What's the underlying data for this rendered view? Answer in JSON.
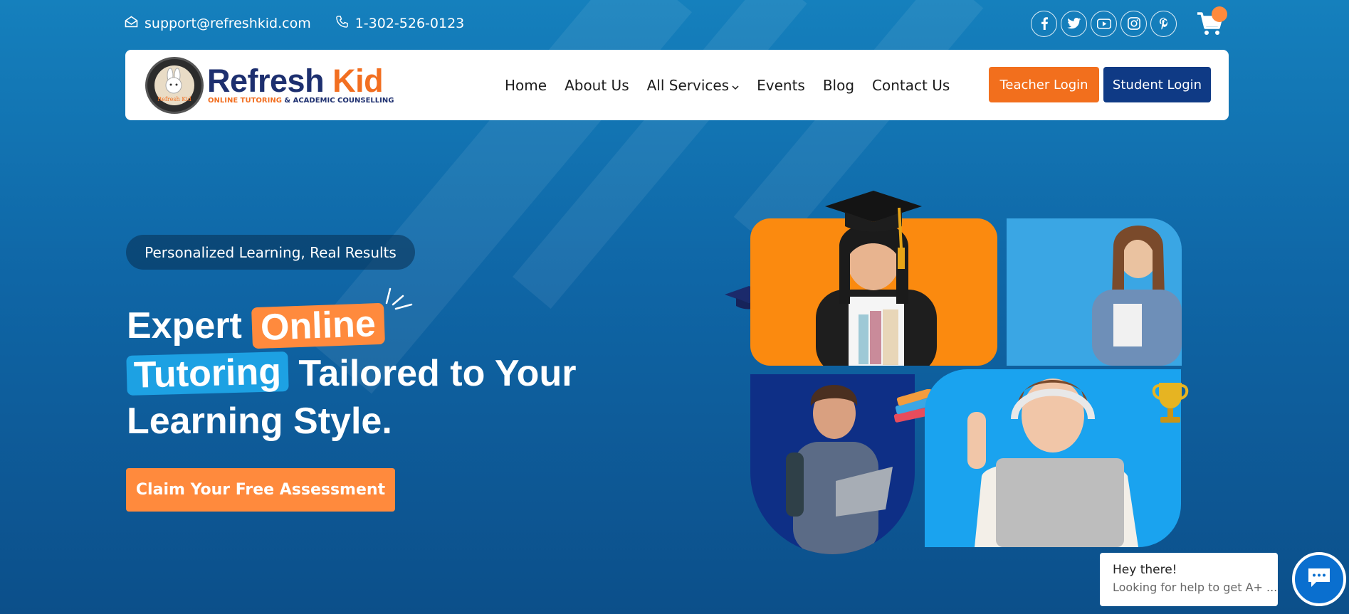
{
  "topbar": {
    "email": "support@refreshkid.com",
    "phone": "1-302-526-0123",
    "socials": [
      "facebook-icon",
      "twitter-icon",
      "youtube-icon",
      "instagram-icon",
      "pinterest-icon"
    ]
  },
  "header": {
    "logo_title_main": "Refresh",
    "logo_title_accent": "Kid",
    "logo_sub_accent": "ONLINE TUTORING",
    "logo_sub_rest": "& ACADEMIC COUNSELLING",
    "logo_badge_text": "Refresh Kid",
    "nav": [
      "Home",
      "About Us",
      "All Services",
      "Events",
      "Blog",
      "Contact Us"
    ],
    "teacher_login": "Teacher Login",
    "student_login": "Student Login"
  },
  "hero": {
    "tagline": "Personalized Learning, Real Results",
    "headline_1": "Expert",
    "headline_online": "Online",
    "headline_tutoring": "Tutoring",
    "headline_2": "Tailored to Your",
    "headline_3": "Learning Style.",
    "cta": "Claim Your Free Assessment"
  },
  "chat": {
    "title": "Hey there!",
    "subtitle": "Looking for help to get A+ ..."
  },
  "colors": {
    "accent_orange": "#f26f1d",
    "brand_navy": "#0f3a85",
    "bg_blue": "#1580bd"
  }
}
